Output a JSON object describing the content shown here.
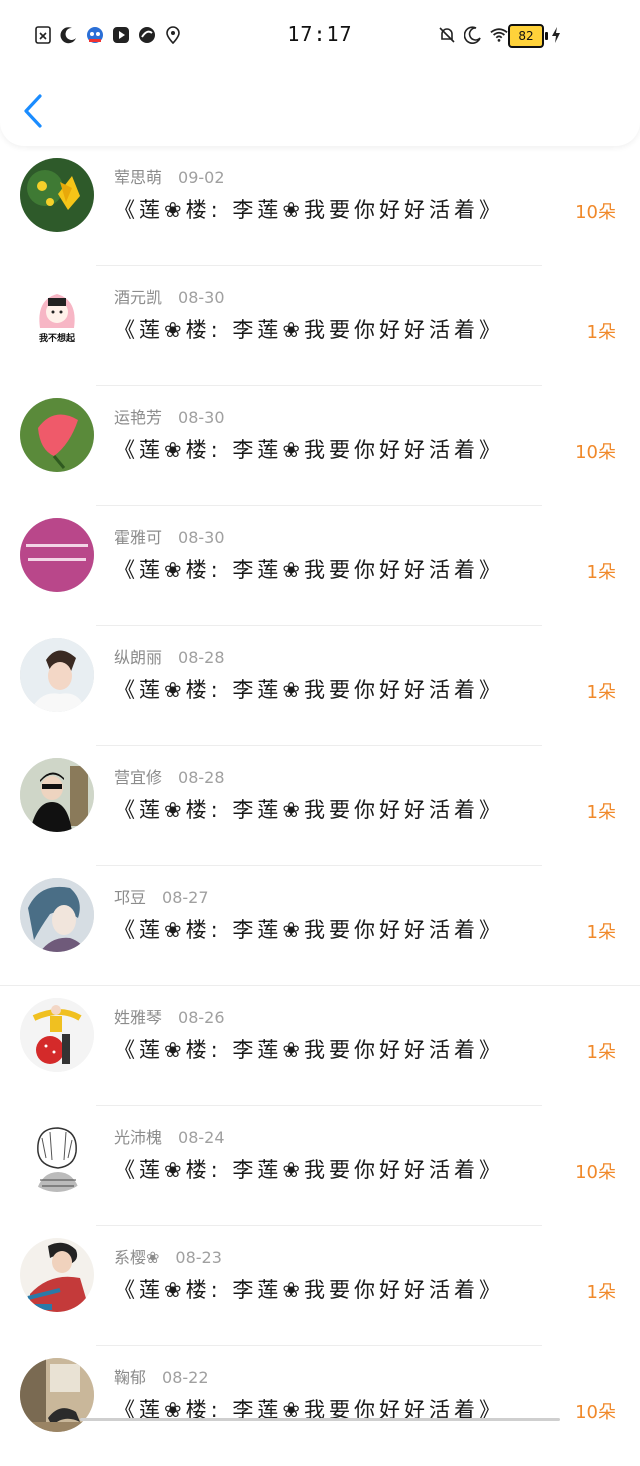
{
  "status": {
    "time": "17:17",
    "battery": "82",
    "left_icons": [
      "sim-off-icon",
      "moon-icon",
      "app-notification-icon",
      "video-app-icon",
      "music-app-icon",
      "location-app-icon"
    ],
    "right_icons": [
      "bell-off-icon",
      "moon-icon",
      "wifi-icon",
      "battery-icon",
      "charging-icon"
    ]
  },
  "header": {
    "back_icon": "chevron-left-icon"
  },
  "colors": {
    "accent": "#1a8cff",
    "count": "#f0892a"
  },
  "items": [
    {
      "name": "荤思萌",
      "date": "09-02",
      "title": "《莲❀楼: 李莲❀我要你好好活着》",
      "count": "10朵",
      "avatar": "flower-yellow"
    },
    {
      "name": "酒元凯",
      "date": "08-30",
      "title": "《莲❀楼: 李莲❀我要你好好活着》",
      "count": "1朵",
      "avatar": "cartoon-girl",
      "avatar_text": "我不想起"
    },
    {
      "name": "运艳芳",
      "date": "08-30",
      "title": "《莲❀楼: 李莲❀我要你好好活着》",
      "count": "10朵",
      "avatar": "flower-pink"
    },
    {
      "name": "霍雅可",
      "date": "08-30",
      "title": "《莲❀楼: 李莲❀我要你好好活着》",
      "count": "1朵",
      "avatar": "magenta-text"
    },
    {
      "name": "纵朗丽",
      "date": "08-28",
      "title": "《莲❀楼: 李莲❀我要你好好活着》",
      "count": "1朵",
      "avatar": "person-light"
    },
    {
      "name": "营宜修",
      "date": "08-28",
      "title": "《莲❀楼: 李莲❀我要你好好活着》",
      "count": "1朵",
      "avatar": "person-dark"
    },
    {
      "name": "邛豆",
      "date": "08-27",
      "title": "《莲❀楼: 李莲❀我要你好好活着》",
      "count": "1朵",
      "avatar": "anime-blue"
    },
    {
      "name": "姓雅琴",
      "date": "08-26",
      "title": "《莲❀楼: 李莲❀我要你好好活着》",
      "count": "1朵",
      "avatar": "strawberry"
    },
    {
      "name": "光沛槐",
      "date": "08-24",
      "title": "《莲❀楼: 李莲❀我要你好好活着》",
      "count": "10朵",
      "avatar": "sketch"
    },
    {
      "name": "系樱❀",
      "date": "08-23",
      "title": "《莲❀楼: 李莲❀我要你好好活着》",
      "count": "1朵",
      "avatar": "person-red"
    },
    {
      "name": "鞠郁",
      "date": "08-22",
      "title": "《莲❀楼: 李莲❀我要你好好活着》",
      "count": "10朵",
      "avatar": "room"
    }
  ]
}
